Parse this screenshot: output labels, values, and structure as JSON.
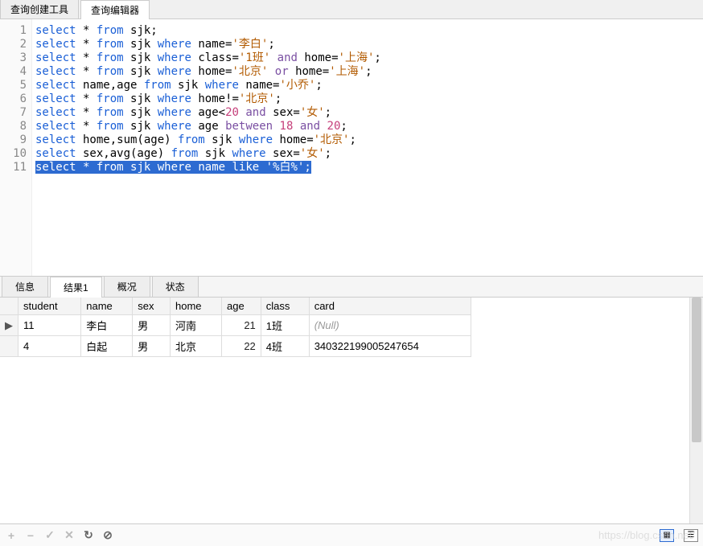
{
  "top_tabs": {
    "create": "查询创建工具",
    "editor": "查询编辑器"
  },
  "code": {
    "lines": [
      {
        "n": 1,
        "t": [
          {
            "c": "kw",
            "v": "select"
          },
          {
            "v": " * "
          },
          {
            "c": "kw",
            "v": "from"
          },
          {
            "v": " sjk;"
          }
        ]
      },
      {
        "n": 2,
        "t": [
          {
            "c": "kw",
            "v": "select"
          },
          {
            "v": " * "
          },
          {
            "c": "kw",
            "v": "from"
          },
          {
            "v": " sjk "
          },
          {
            "c": "kw",
            "v": "where"
          },
          {
            "v": " name="
          },
          {
            "c": "str",
            "v": "'李白'"
          },
          {
            "v": ";"
          }
        ]
      },
      {
        "n": 3,
        "t": [
          {
            "c": "kw",
            "v": "select"
          },
          {
            "v": " * "
          },
          {
            "c": "kw",
            "v": "from"
          },
          {
            "v": " sjk "
          },
          {
            "c": "kw",
            "v": "where"
          },
          {
            "v": " class="
          },
          {
            "c": "str",
            "v": "'1班'"
          },
          {
            "v": " "
          },
          {
            "c": "op",
            "v": "and"
          },
          {
            "v": " home="
          },
          {
            "c": "str",
            "v": "'上海'"
          },
          {
            "v": ";"
          }
        ]
      },
      {
        "n": 4,
        "t": [
          {
            "c": "kw",
            "v": "select"
          },
          {
            "v": " * "
          },
          {
            "c": "kw",
            "v": "from"
          },
          {
            "v": " sjk "
          },
          {
            "c": "kw",
            "v": "where"
          },
          {
            "v": " home="
          },
          {
            "c": "str",
            "v": "'北京'"
          },
          {
            "v": " "
          },
          {
            "c": "op",
            "v": "or"
          },
          {
            "v": " home="
          },
          {
            "c": "str",
            "v": "'上海'"
          },
          {
            "v": ";"
          }
        ]
      },
      {
        "n": 5,
        "t": [
          {
            "c": "kw",
            "v": "select"
          },
          {
            "v": " name,age "
          },
          {
            "c": "kw",
            "v": "from"
          },
          {
            "v": " sjk "
          },
          {
            "c": "kw",
            "v": "where"
          },
          {
            "v": " name="
          },
          {
            "c": "str",
            "v": "'小乔'"
          },
          {
            "v": ";"
          }
        ]
      },
      {
        "n": 6,
        "t": [
          {
            "c": "kw",
            "v": "select"
          },
          {
            "v": " * "
          },
          {
            "c": "kw",
            "v": "from"
          },
          {
            "v": " sjk "
          },
          {
            "c": "kw",
            "v": "where"
          },
          {
            "v": " home!="
          },
          {
            "c": "str",
            "v": "'北京'"
          },
          {
            "v": ";"
          }
        ]
      },
      {
        "n": 7,
        "t": [
          {
            "c": "kw",
            "v": "select"
          },
          {
            "v": " * "
          },
          {
            "c": "kw",
            "v": "from"
          },
          {
            "v": " sjk "
          },
          {
            "c": "kw",
            "v": "where"
          },
          {
            "v": " age<"
          },
          {
            "c": "num",
            "v": "20"
          },
          {
            "v": " "
          },
          {
            "c": "op",
            "v": "and"
          },
          {
            "v": " sex="
          },
          {
            "c": "str",
            "v": "'女'"
          },
          {
            "v": ";"
          }
        ]
      },
      {
        "n": 8,
        "t": [
          {
            "c": "kw",
            "v": "select"
          },
          {
            "v": " * "
          },
          {
            "c": "kw",
            "v": "from"
          },
          {
            "v": " sjk "
          },
          {
            "c": "kw",
            "v": "where"
          },
          {
            "v": " age "
          },
          {
            "c": "op",
            "v": "between"
          },
          {
            "v": " "
          },
          {
            "c": "num",
            "v": "18"
          },
          {
            "v": " "
          },
          {
            "c": "op",
            "v": "and"
          },
          {
            "v": " "
          },
          {
            "c": "num",
            "v": "20"
          },
          {
            "v": ";"
          }
        ]
      },
      {
        "n": 9,
        "t": [
          {
            "c": "kw",
            "v": "select"
          },
          {
            "v": " home,sum(age) "
          },
          {
            "c": "kw",
            "v": "from"
          },
          {
            "v": " sjk "
          },
          {
            "c": "kw",
            "v": "where"
          },
          {
            "v": " home="
          },
          {
            "c": "str",
            "v": "'北京'"
          },
          {
            "v": ";"
          }
        ]
      },
      {
        "n": 10,
        "t": [
          {
            "c": "kw",
            "v": "select"
          },
          {
            "v": " sex,avg(age) "
          },
          {
            "c": "kw",
            "v": "from"
          },
          {
            "v": " sjk "
          },
          {
            "c": "kw",
            "v": "where"
          },
          {
            "v": " sex="
          },
          {
            "c": "str",
            "v": "'女'"
          },
          {
            "v": ";"
          }
        ]
      },
      {
        "n": 11,
        "sel": true,
        "t": [
          {
            "c": "kw",
            "v": "select"
          },
          {
            "v": " * "
          },
          {
            "c": "kw",
            "v": "from"
          },
          {
            "v": " sjk "
          },
          {
            "c": "kw",
            "v": "where"
          },
          {
            "v": " name "
          },
          {
            "c": "op",
            "v": "like"
          },
          {
            "v": " "
          },
          {
            "c": "str",
            "v": "'%白%'"
          },
          {
            "v": ";"
          }
        ]
      }
    ]
  },
  "bottom_tabs": {
    "info": "信息",
    "result": "结果1",
    "profile": "概况",
    "status": "状态"
  },
  "result": {
    "headers": [
      "student",
      "name",
      "sex",
      "home",
      "age",
      "class",
      "card"
    ],
    "rows": [
      {
        "ptr": "▶",
        "student": "11",
        "name": "李白",
        "sex": "男",
        "home": "河南",
        "age": "21",
        "class": "1班",
        "card": "(Null)",
        "null_card": true
      },
      {
        "ptr": "",
        "student": "4",
        "name": "白起",
        "sex": "男",
        "home": "北京",
        "age": "22",
        "class": "4班",
        "card": "340322199005247654"
      }
    ]
  },
  "footer": {
    "add": "+",
    "remove": "−",
    "check": "✓",
    "cross": "✕",
    "refresh": "↻",
    "stop": "⊘"
  },
  "watermark": "https://blog.csdn.net/"
}
